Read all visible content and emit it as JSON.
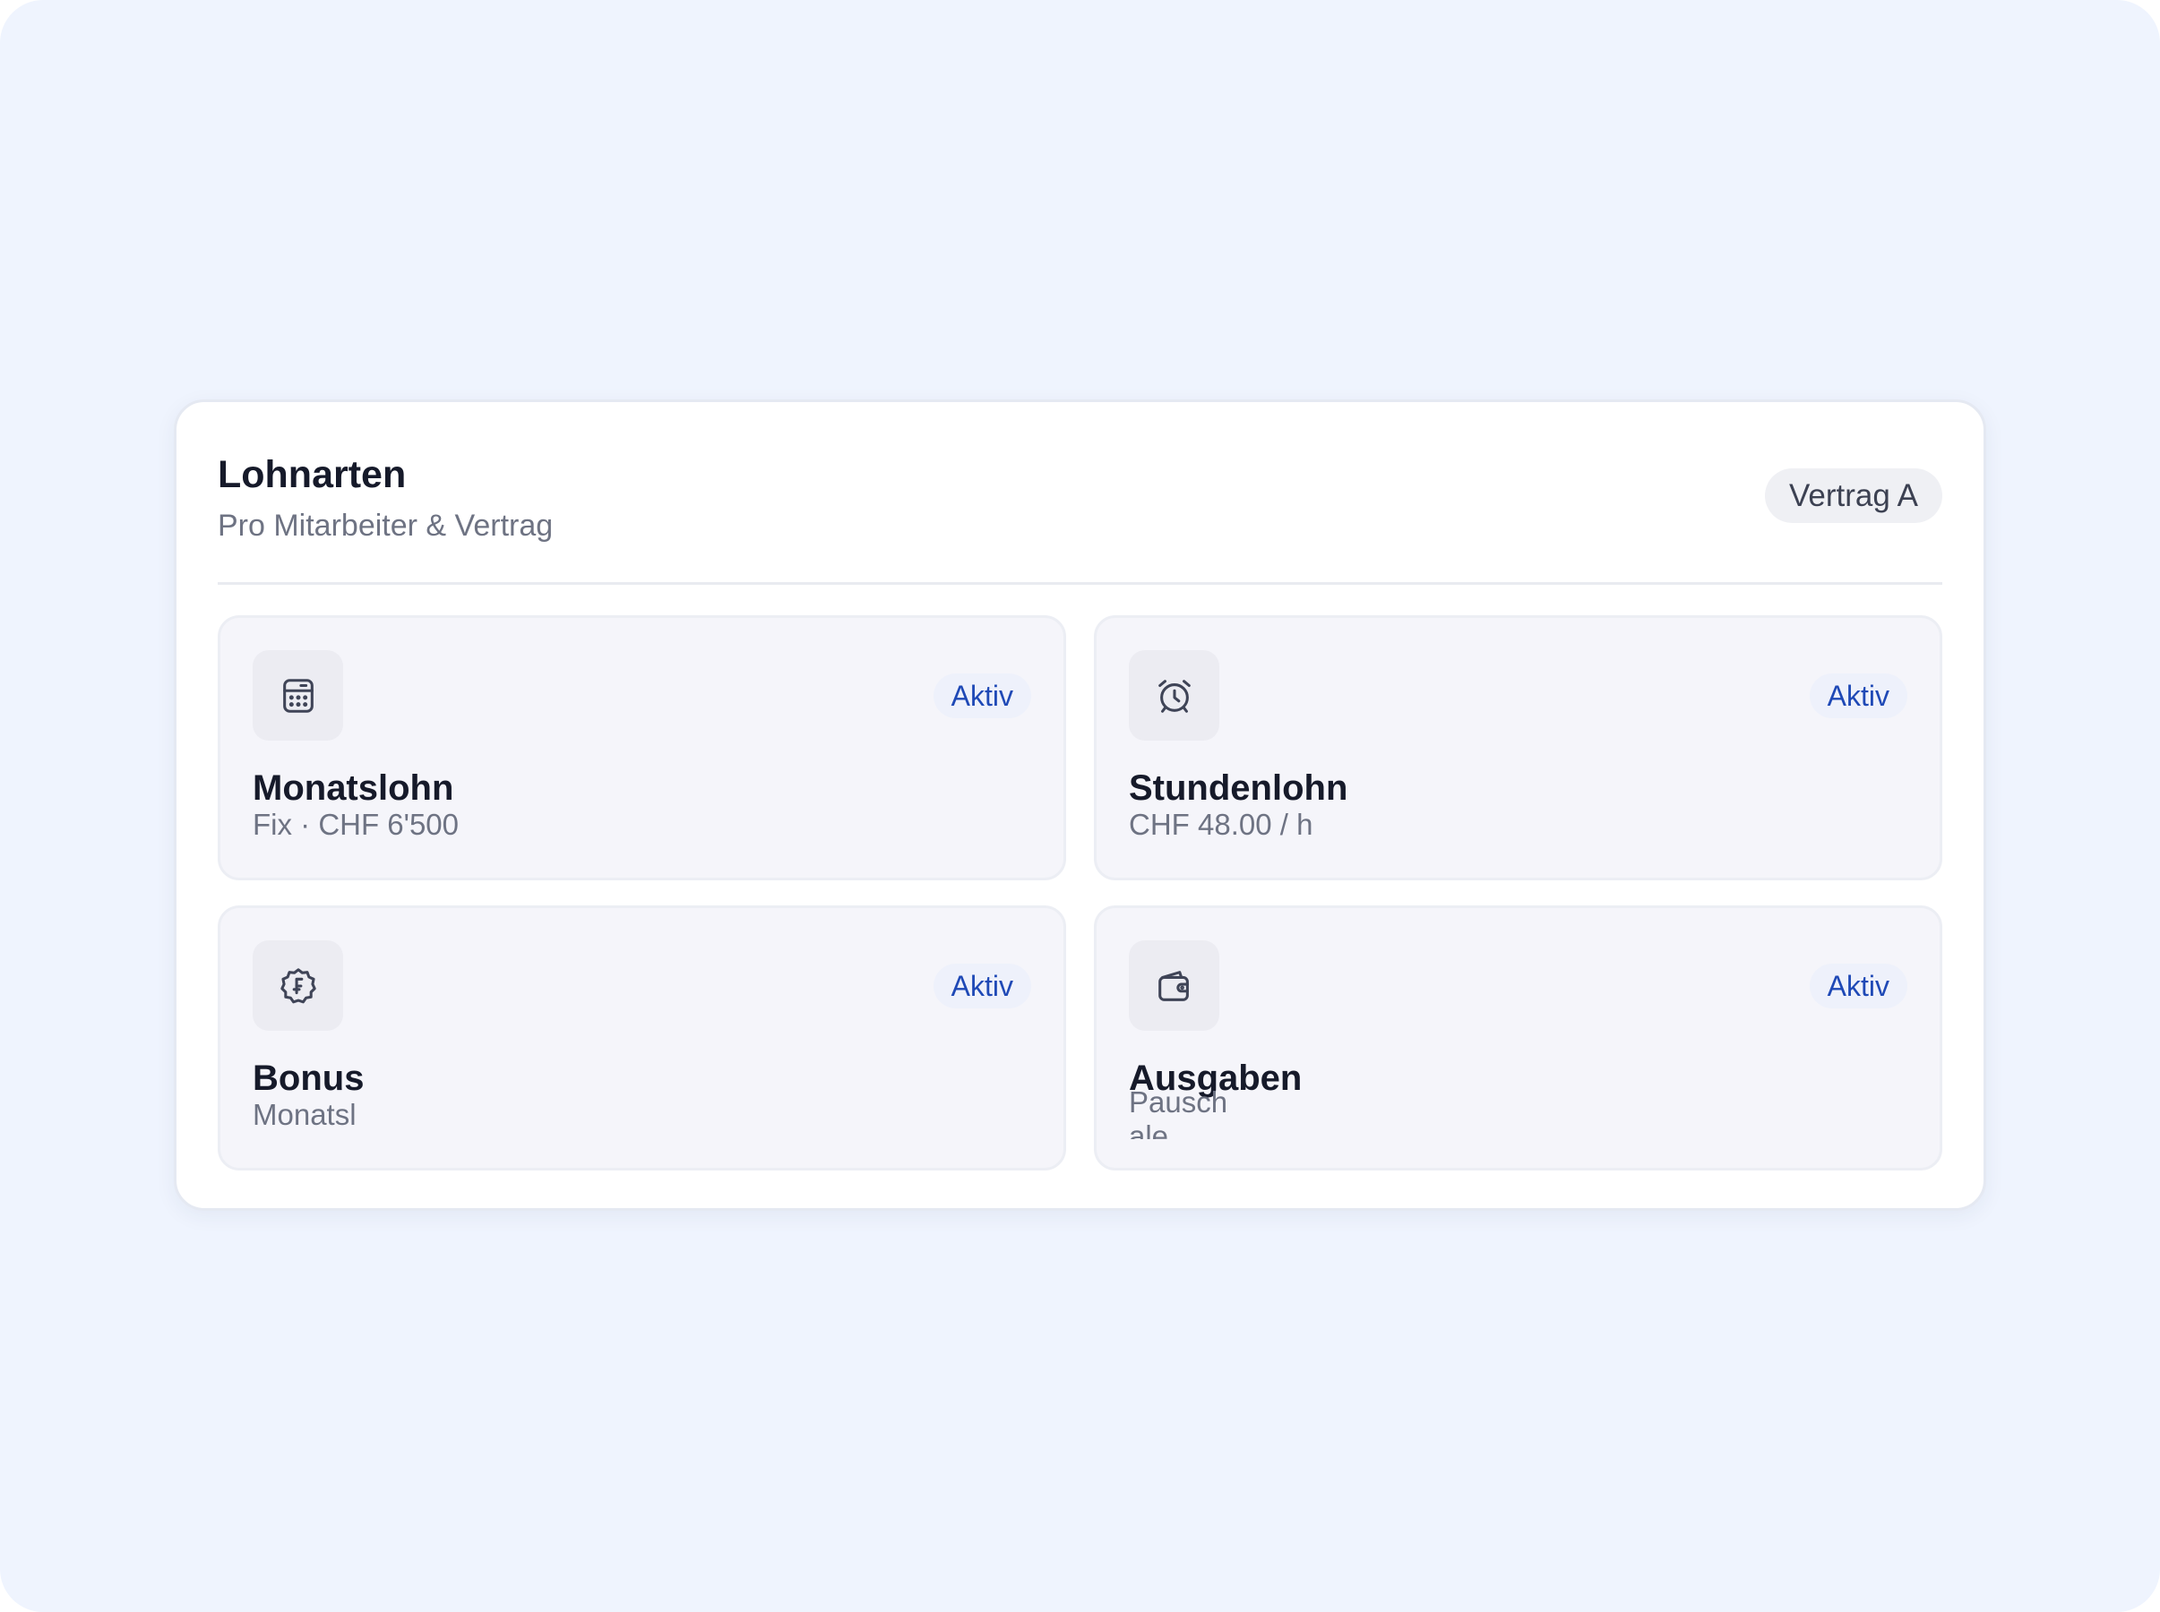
{
  "header": {
    "title": "Lohnarten",
    "subtitle": "Pro Mitarbeiter & Vertrag",
    "contract_label": "Vertrag A"
  },
  "cards": [
    {
      "title": "Monatslohn",
      "subtitle": "Fix · CHF 6'500",
      "status": "Aktiv",
      "icon": "calculator-icon"
    },
    {
      "title": "Stundenlohn",
      "subtitle": "CHF 48.00 / h",
      "status": "Aktiv",
      "icon": "alarm-clock-icon"
    },
    {
      "title": "Bonus",
      "subtitle": "Monatsl",
      "status": "Aktiv",
      "icon": "franc-badge-icon"
    },
    {
      "title": "Ausgaben",
      "subtitle": "Pauschale",
      "status": "Aktiv",
      "icon": "wallet-icon"
    }
  ],
  "colors": {
    "background": "#eff4fe",
    "accent": "#1f49b6",
    "title_text": "#161a2a",
    "muted_text": "#6e7383"
  }
}
